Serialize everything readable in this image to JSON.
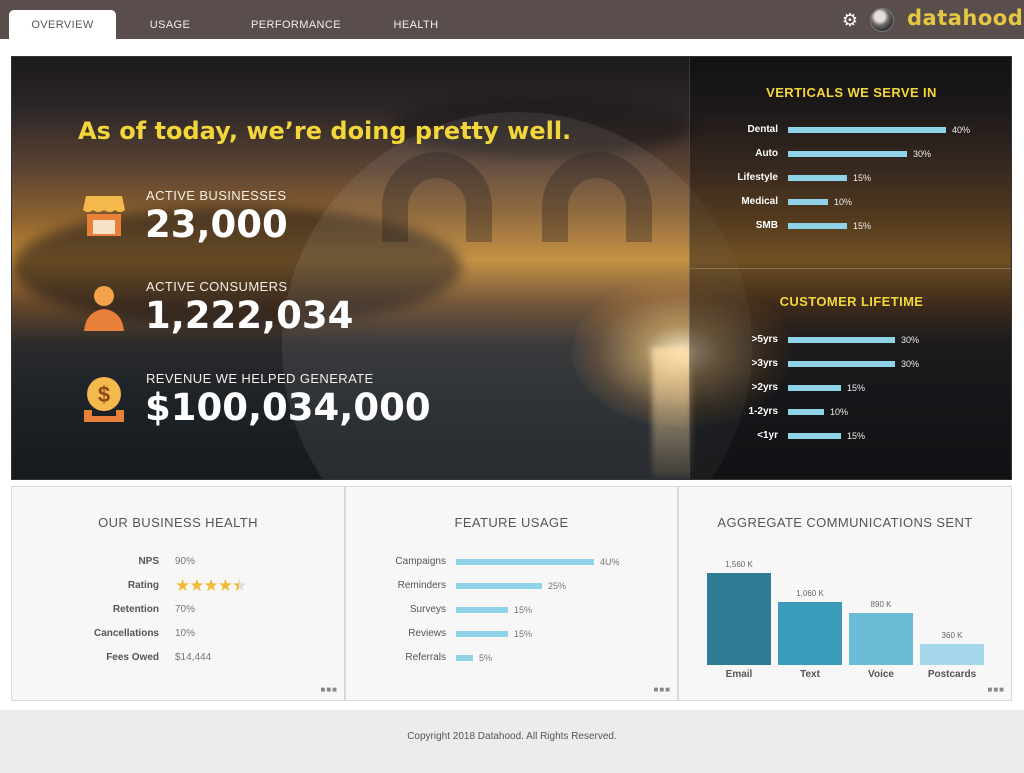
{
  "nav": {
    "tabs": [
      "OVERVIEW",
      "USAGE",
      "PERFORMANCE",
      "HEALTH"
    ],
    "active_tab": "OVERVIEW",
    "brand": "datahood"
  },
  "hero": {
    "headline": "As of today, we’re doing pretty well.",
    "stats": [
      {
        "label": "ACTIVE BUSINESSES",
        "value": "23,000",
        "icon": "storefront-icon"
      },
      {
        "label": "ACTIVE CONSUMERS",
        "value": "1,222,034",
        "icon": "person-icon"
      },
      {
        "label": "REVENUE WE HELPED GENERATE",
        "value": "$100,034,000",
        "icon": "money-bag-icon"
      }
    ],
    "verticals": {
      "title": "VERTICALS WE SERVE IN",
      "items": [
        {
          "label": "Dental",
          "value": 40,
          "pct": "40%"
        },
        {
          "label": "Auto",
          "value": 30,
          "pct": "30%"
        },
        {
          "label": "Lifestyle",
          "value": 15,
          "pct": "15%"
        },
        {
          "label": "Medical",
          "value": 10,
          "pct": "10%"
        },
        {
          "label": "SMB",
          "value": 15,
          "pct": "15%"
        }
      ]
    },
    "lifetime": {
      "title": "CUSTOMER LIFETIME",
      "items": [
        {
          "label": ">5yrs",
          "value": 30,
          "pct": "30%"
        },
        {
          "label": ">3yrs",
          "value": 30,
          "pct": "30%"
        },
        {
          "label": ">2yrs",
          "value": 15,
          "pct": "15%"
        },
        {
          "label": "1-2yrs",
          "value": 10,
          "pct": "10%"
        },
        {
          "label": "<1yr",
          "value": 15,
          "pct": "15%"
        }
      ]
    }
  },
  "health": {
    "title": "OUR BUSINESS HEALTH",
    "rows": [
      {
        "key": "NPS",
        "value": "90%"
      },
      {
        "key": "Rating",
        "value": "",
        "stars": 4.5,
        "stars_text": "★★★★★"
      },
      {
        "key": "Retention",
        "value": "70%"
      },
      {
        "key": "Cancellations",
        "value": "10%"
      },
      {
        "key": "Fees Owed",
        "value": "$14,444"
      }
    ]
  },
  "feature_usage": {
    "title": "FEATURE USAGE",
    "items": [
      {
        "label": "Campaigns",
        "value": 40,
        "pct": "4U%"
      },
      {
        "label": "Reminders",
        "value": 25,
        "pct": "25%"
      },
      {
        "label": "Surveys",
        "value": 15,
        "pct": "15%"
      },
      {
        "label": "Reviews",
        "value": 15,
        "pct": "15%"
      },
      {
        "label": "Referrals",
        "value": 5,
        "pct": "5%"
      }
    ]
  },
  "communications": {
    "title": "AGGREGATE COMMUNICATIONS SENT",
    "items": [
      {
        "label": "Email",
        "value": 1560,
        "display": "1,560 K",
        "color": "#2f7c95"
      },
      {
        "label": "Text",
        "value": 1060,
        "display": "1,060 K",
        "color": "#3b9bbb"
      },
      {
        "label": "Voice",
        "value": 890,
        "display": "890 K",
        "color": "#6cbcd8"
      },
      {
        "label": "Postcards",
        "value": 360,
        "display": "360 K",
        "color": "#a5d8ea"
      }
    ]
  },
  "chart_data": [
    {
      "type": "bar",
      "orientation": "horizontal",
      "title": "VERTICALS WE SERVE IN",
      "categories": [
        "Dental",
        "Auto",
        "Lifestyle",
        "Medical",
        "SMB"
      ],
      "values": [
        40,
        30,
        15,
        10,
        15
      ]
    },
    {
      "type": "bar",
      "orientation": "horizontal",
      "title": "CUSTOMER LIFETIME",
      "categories": [
        ">5yrs",
        ">3yrs",
        ">2yrs",
        "1-2yrs",
        "<1yr"
      ],
      "values": [
        30,
        30,
        15,
        10,
        15
      ]
    },
    {
      "type": "bar",
      "orientation": "horizontal",
      "title": "FEATURE USAGE",
      "categories": [
        "Campaigns",
        "Reminders",
        "Surveys",
        "Reviews",
        "Referrals"
      ],
      "values": [
        40,
        25,
        15,
        15,
        5
      ]
    },
    {
      "type": "bar",
      "title": "AGGREGATE COMMUNICATIONS SENT",
      "categories": [
        "Email",
        "Text",
        "Voice",
        "Postcards"
      ],
      "values": [
        1560,
        1060,
        890,
        360
      ]
    }
  ],
  "footer": {
    "copyright": "Copyright 2018 Datahood. All Rights Reserved."
  },
  "icons": {
    "settings": "gear-icon",
    "more": "more-dots-icon"
  },
  "colors": {
    "accent": "#f2d63a",
    "bar": "#8fd3e8",
    "topbar": "#5a4e4c",
    "stars": "#f3b938"
  }
}
